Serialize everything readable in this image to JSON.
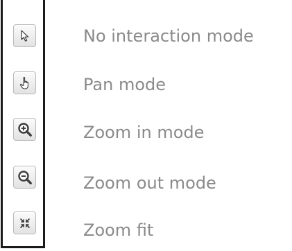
{
  "tools": [
    {
      "label": "No interaction mode",
      "icon": "arrow-cursor-icon"
    },
    {
      "label": "Pan mode",
      "icon": "hand-pointer-icon"
    },
    {
      "label": "Zoom in mode",
      "icon": "zoom-in-icon"
    },
    {
      "label": "Zoom out mode",
      "icon": "zoom-out-icon"
    },
    {
      "label": "Zoom fit",
      "icon": "zoom-fit-icon"
    }
  ]
}
